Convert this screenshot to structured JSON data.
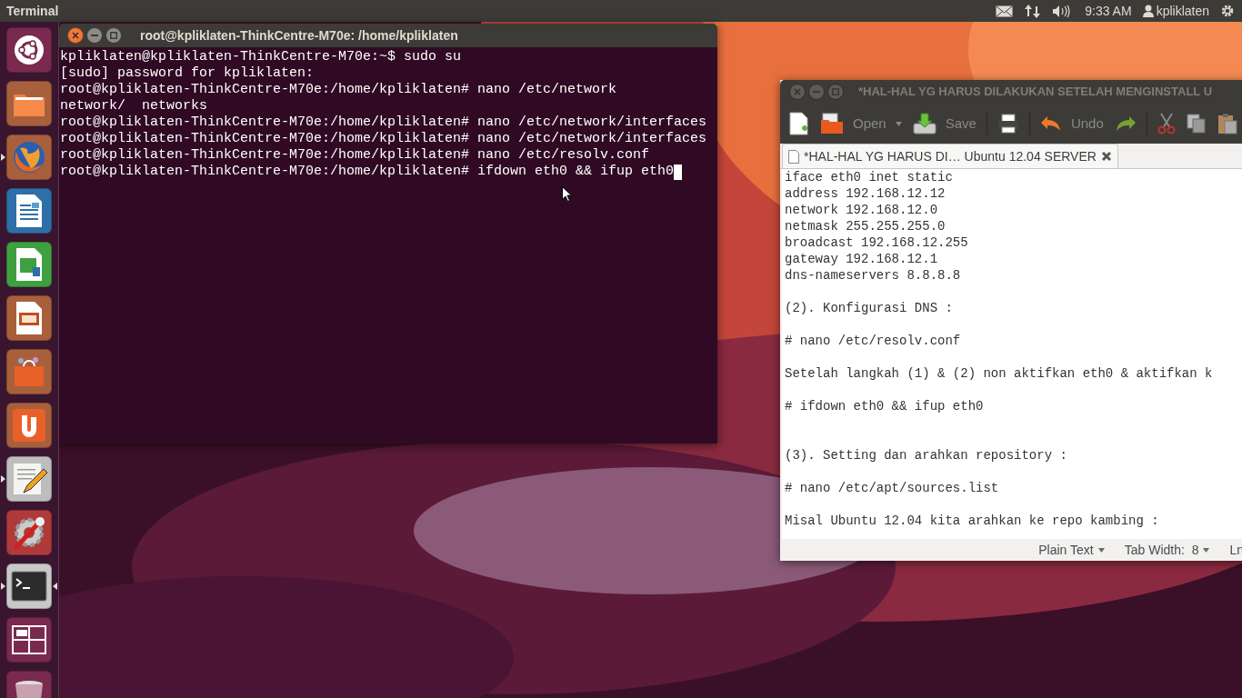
{
  "top_panel": {
    "app_title": "Terminal",
    "clock": "9:33 AM",
    "user": "kpliklaten"
  },
  "launcher": [
    {
      "kind": "dash",
      "running": false,
      "active": false
    },
    {
      "kind": "files",
      "running": false,
      "active": false
    },
    {
      "kind": "firefox",
      "running": true,
      "active": false
    },
    {
      "kind": "writer",
      "running": false,
      "active": false
    },
    {
      "kind": "calc",
      "running": false,
      "active": false
    },
    {
      "kind": "impress",
      "running": false,
      "active": false
    },
    {
      "kind": "software",
      "running": false,
      "active": false
    },
    {
      "kind": "ubuntu-one",
      "running": false,
      "active": false
    },
    {
      "kind": "text-editor",
      "running": true,
      "active": false
    },
    {
      "kind": "settings",
      "running": false,
      "active": false
    },
    {
      "kind": "terminal",
      "running": true,
      "active": true
    },
    {
      "kind": "workspaces",
      "running": false,
      "active": false
    },
    {
      "kind": "trash",
      "running": false,
      "active": false
    }
  ],
  "terminal": {
    "title": "root@kpliklaten-ThinkCentre-M70e: /home/kpliklaten",
    "focused": true,
    "lines": [
      {
        "text": "kpliklaten@kpliklaten-ThinkCentre-M70e:~$ sudo su",
        "cursor": false
      },
      {
        "text": "[sudo] password for kpliklaten:",
        "cursor": false
      },
      {
        "text": "root@kpliklaten-ThinkCentre-M70e:/home/kpliklaten# nano /etc/network",
        "cursor": false
      },
      {
        "text": "network/  networks",
        "cursor": false
      },
      {
        "text": "root@kpliklaten-ThinkCentre-M70e:/home/kpliklaten# nano /etc/network/interfaces",
        "cursor": false
      },
      {
        "text": "root@kpliklaten-ThinkCentre-M70e:/home/kpliklaten# nano /etc/network/interfaces",
        "cursor": false
      },
      {
        "text": "root@kpliklaten-ThinkCentre-M70e:/home/kpliklaten# nano /etc/resolv.conf",
        "cursor": false
      },
      {
        "text": "root@kpliklaten-ThinkCentre-M70e:/home/kpliklaten# ifdown eth0 && ifup eth0",
        "cursor": true
      }
    ]
  },
  "editor": {
    "title": "*HAL-HAL YG HARUS DILAKUKAN SETELAH MENGINSTALL U",
    "focused": false,
    "toolbar": [
      {
        "kind": "new"
      },
      {
        "kind": "open",
        "label": "Open"
      },
      {
        "kind": "save",
        "label": "Save"
      },
      {
        "kind": "print"
      },
      {
        "kind": "undo",
        "label": "Undo"
      },
      {
        "kind": "redo"
      },
      {
        "kind": "cut"
      },
      {
        "kind": "copy"
      },
      {
        "kind": "paste"
      }
    ],
    "tab": {
      "label": "*HAL-HAL YG HARUS DI… Ubuntu 12.04 SERVER"
    },
    "lines": [
      {
        "kind": "text",
        "text": "iface eth0 inet static"
      },
      {
        "kind": "text",
        "text": "address 192.168.12.12"
      },
      {
        "kind": "text",
        "text": "network 192.168.12.0"
      },
      {
        "kind": "text",
        "text": "netmask 255.255.255.0"
      },
      {
        "kind": "text",
        "text": "broadcast 192.168.12.255"
      },
      {
        "kind": "text",
        "text": "gateway 192.168.12.1"
      },
      {
        "kind": "text",
        "text": "dns-nameservers 8.8.8.8"
      },
      {
        "kind": "blank"
      },
      {
        "kind": "text",
        "text": "(2). Konfigurasi DNS :"
      },
      {
        "kind": "blank"
      },
      {
        "kind": "text",
        "text": "# nano /etc/resolv.conf"
      },
      {
        "kind": "blank"
      },
      {
        "kind": "text",
        "text": "Setelah langkah (1) & (2) non aktifkan eth0 & aktifkan k"
      },
      {
        "kind": "blank"
      },
      {
        "kind": "text",
        "text": "# ifdown eth0 && ifup eth0"
      },
      {
        "kind": "blank"
      },
      {
        "kind": "blank"
      },
      {
        "kind": "text",
        "text": "(3). Setting dan arahkan repository :"
      },
      {
        "kind": "blank"
      },
      {
        "kind": "text",
        "text": "# nano /etc/apt/sources.list"
      },
      {
        "kind": "blank"
      },
      {
        "kind": "text",
        "text": "Misal Ubuntu 12.04 kita arahkan ke repo kambing :"
      }
    ],
    "status": [
      {
        "text": "Plain Text",
        "dropdown": true
      },
      {
        "text": "Tab Width:  8",
        "dropdown": true
      },
      {
        "text": "Ln",
        "dropdown": false
      }
    ]
  }
}
